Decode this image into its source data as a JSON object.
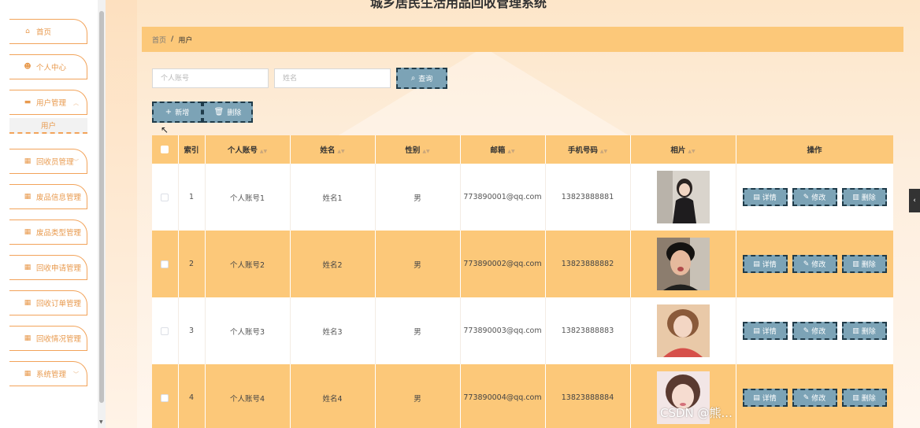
{
  "app_title": "城乡居民生活用品回收管理系统",
  "sidebar": {
    "items": [
      {
        "label": "首页",
        "icon": "home-icon",
        "glyph": "⌂",
        "has_caret": false
      },
      {
        "label": "个人中心",
        "icon": "person-icon",
        "glyph": "☻",
        "has_caret": false
      },
      {
        "label": "用户管理",
        "icon": "users-icon",
        "glyph": "▬",
        "has_caret": true
      },
      {
        "label": "回收员管理",
        "icon": "grid-icon",
        "glyph": "▦",
        "has_caret": true
      },
      {
        "label": "废品信息管理",
        "icon": "grid-icon",
        "glyph": "▦",
        "has_caret": true
      },
      {
        "label": "废品类型管理",
        "icon": "grid-icon",
        "glyph": "▦",
        "has_caret": true
      },
      {
        "label": "回收申请管理",
        "icon": "grid-icon",
        "glyph": "▦",
        "has_caret": true
      },
      {
        "label": "回收订单管理",
        "icon": "grid-icon",
        "glyph": "▦",
        "has_caret": true
      },
      {
        "label": "回收情况管理",
        "icon": "grid-icon",
        "glyph": "▦",
        "has_caret": true
      },
      {
        "label": "系统管理",
        "icon": "grid-icon",
        "glyph": "▦",
        "has_caret": true
      }
    ],
    "submenu": {
      "label": "用户"
    }
  },
  "breadcrumb": {
    "home": "首页",
    "separator": "/",
    "current": "用户"
  },
  "search": {
    "account_placeholder": "个人账号",
    "name_placeholder": "姓名",
    "search_label": "查询"
  },
  "actions": {
    "add_label": "新增",
    "delete_label": "删除"
  },
  "table": {
    "columns": [
      "索引",
      "个人账号",
      "姓名",
      "性别",
      "邮箱",
      "手机号码",
      "相片",
      "操作"
    ],
    "op_labels": {
      "detail": "详情",
      "edit": "修改",
      "delete": "删除"
    },
    "rows": [
      {
        "index": "1",
        "account": "个人账号1",
        "name": "姓名1",
        "gender": "男",
        "email": "773890001@qq.com",
        "phone": "13823888881"
      },
      {
        "index": "2",
        "account": "个人账号2",
        "name": "姓名2",
        "gender": "男",
        "email": "773890002@qq.com",
        "phone": "13823888882"
      },
      {
        "index": "3",
        "account": "个人账号3",
        "name": "姓名3",
        "gender": "男",
        "email": "773890003@qq.com",
        "phone": "13823888883"
      },
      {
        "index": "4",
        "account": "个人账号4",
        "name": "姓名4",
        "gender": "男",
        "email": "773890004@qq.com",
        "phone": "13823888884"
      }
    ]
  },
  "watermark": "CSDN @熊...",
  "colors": {
    "accent": "#fcc879",
    "menu_border": "#f2a35a",
    "button": "#7ca3b6",
    "button_border": "#1f3b4a"
  }
}
